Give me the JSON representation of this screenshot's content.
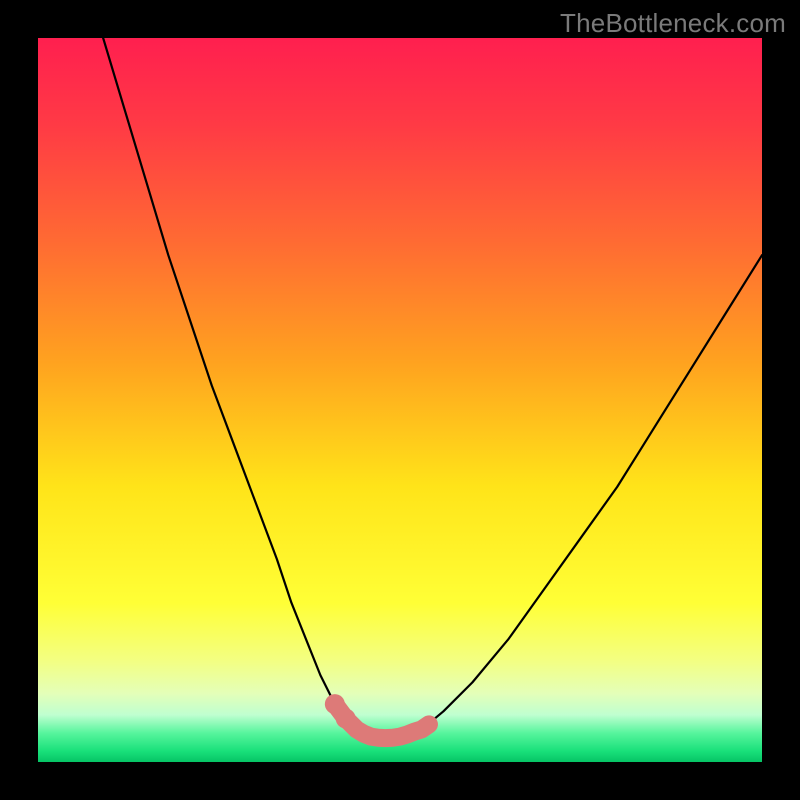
{
  "watermark": {
    "text": "TheBottleneck.com"
  },
  "colors": {
    "page_bg": "#000000",
    "gradient_stops": [
      {
        "offset": 0.0,
        "color": "#ff1f4f"
      },
      {
        "offset": 0.12,
        "color": "#ff3a45"
      },
      {
        "offset": 0.28,
        "color": "#ff6a33"
      },
      {
        "offset": 0.45,
        "color": "#ffa31f"
      },
      {
        "offset": 0.62,
        "color": "#ffe419"
      },
      {
        "offset": 0.78,
        "color": "#ffff36"
      },
      {
        "offset": 0.86,
        "color": "#f3ff82"
      },
      {
        "offset": 0.905,
        "color": "#e4ffb8"
      },
      {
        "offset": 0.935,
        "color": "#bfffd0"
      },
      {
        "offset": 0.96,
        "color": "#57f59d"
      },
      {
        "offset": 0.985,
        "color": "#19e07a"
      },
      {
        "offset": 1.0,
        "color": "#06c465"
      }
    ],
    "curve_stroke": "#000000",
    "marker_fill": "#dd7a78",
    "marker_stroke": "#dd7a78"
  },
  "chart_data": {
    "type": "line",
    "title": "",
    "xlabel": "",
    "ylabel": "",
    "xlim": [
      0,
      100
    ],
    "ylim": [
      0,
      100
    ],
    "grid": false,
    "legend": false,
    "series": [
      {
        "name": "bottleneck-curve",
        "x": [
          9,
          12,
          15,
          18,
          21,
          24,
          27,
          30,
          33,
          35,
          37,
          39,
          41,
          42.5,
          44,
          46,
          48,
          50,
          53,
          56,
          60,
          65,
          70,
          75,
          80,
          85,
          90,
          95,
          100
        ],
        "y": [
          100,
          90,
          80,
          70,
          61,
          52,
          44,
          36,
          28,
          22,
          17,
          12,
          8,
          6,
          4.5,
          3.5,
          3.3,
          3.5,
          4.5,
          7,
          11,
          17,
          24,
          31,
          38,
          46,
          54,
          62,
          70
        ]
      }
    ],
    "markers": {
      "name": "highlight-band",
      "x": [
        41,
        42.5,
        44,
        45,
        46,
        47,
        48,
        49,
        50,
        51,
        52,
        53,
        54
      ],
      "y": [
        8,
        6,
        4.5,
        3.9,
        3.5,
        3.35,
        3.3,
        3.35,
        3.5,
        3.8,
        4.2,
        4.5,
        5.2
      ]
    }
  }
}
